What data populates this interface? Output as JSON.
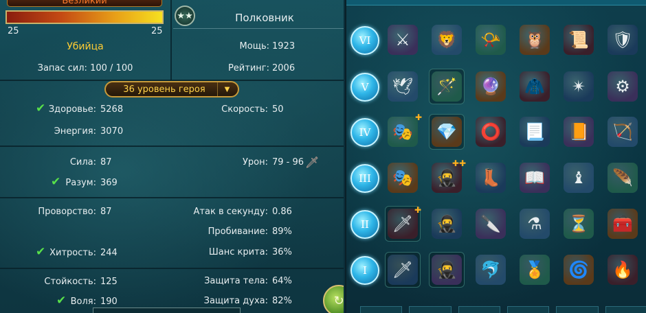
{
  "hero": {
    "name": "Безликий",
    "level_min": "25",
    "level_max": "25",
    "xp_fraction": 1.0,
    "class": "Убийца",
    "stamina_label": "Запас сил:",
    "stamina_value": "100 / 100",
    "rank_icon": "laurel-stars-icon",
    "rank": "Полковник",
    "power_label": "Мощь:",
    "power_value": "1923",
    "rating_label": "Рейтинг:",
    "rating_value": "2006",
    "level_selector": "36 уровень героя"
  },
  "stats": {
    "health_label": "Здоровье:",
    "health_value": "5268",
    "speed_label": "Скорость:",
    "speed_value": "50",
    "energy_label": "Энергия:",
    "energy_value": "3070",
    "strength_label": "Сила:",
    "strength_value": "87",
    "damage_label": "Урон:",
    "damage_value": "79 - 96",
    "mind_label": "Разум:",
    "mind_value": "369",
    "agility_label": "Проворство:",
    "agility_value": "87",
    "aps_label": "Атак в секунду:",
    "aps_value": "0.86",
    "pierce_label": "Пробивание:",
    "pierce_value": "89%",
    "cunning_label": "Хитрость:",
    "cunning_value": "244",
    "crit_label": "Шанс крита:",
    "crit_value": "36%",
    "stamina2_label": "Стойкость:",
    "stamina2_value": "125",
    "body_def_label": "Защита тела:",
    "body_def_value": "64%",
    "will_label": "Воля:",
    "will_value": "190",
    "spirit_def_label": "Защита духа:",
    "spirit_def_value": "82%"
  },
  "colors": {
    "accent_gold": "#ffcc33",
    "check_green": "#58e04a",
    "tier_blue": "#2fb6e8"
  },
  "talents": {
    "tiers": [
      "VI",
      "V",
      "IV",
      "III",
      "II",
      "I"
    ],
    "rows": [
      [
        {
          "icon": "winged-sword-icon",
          "glyph": "⚔"
        },
        {
          "icon": "golden-beast-icon",
          "glyph": "🦁"
        },
        {
          "icon": "curved-horn-icon",
          "glyph": "📯"
        },
        {
          "icon": "owl-banner-icon",
          "glyph": "🦉"
        },
        {
          "icon": "magic-scroll-icon",
          "glyph": "📜"
        },
        {
          "icon": "shield-sword-icon",
          "glyph": "🛡"
        }
      ],
      [
        {
          "icon": "silver-wings-icon",
          "glyph": "🕊"
        },
        {
          "icon": "ruby-wand-icon",
          "glyph": "🪄"
        },
        {
          "icon": "emerald-staff-icon",
          "glyph": "🔮"
        },
        {
          "icon": "green-cloak-icon",
          "glyph": "🧥"
        },
        {
          "icon": "spinning-blades-icon",
          "glyph": "✴"
        },
        {
          "icon": "spiked-mace-icon",
          "glyph": "⚙"
        }
      ],
      [
        {
          "icon": "white-mask-icon",
          "glyph": "🎭"
        },
        {
          "icon": "prism-crystal-icon",
          "glyph": "💎"
        },
        {
          "icon": "gold-bracelet-icon",
          "glyph": "⭕"
        },
        {
          "icon": "rune-scroll-icon",
          "glyph": "📃"
        },
        {
          "icon": "ancient-tome-icon",
          "glyph": "📙"
        },
        {
          "icon": "green-arrow-icon",
          "glyph": "🏹"
        }
      ],
      [
        {
          "icon": "white-mask-icon",
          "glyph": "🎭"
        },
        {
          "icon": "hooded-rogue-icon",
          "glyph": "🥷"
        },
        {
          "icon": "iron-boots-icon",
          "glyph": "👢"
        },
        {
          "icon": "open-book-icon",
          "glyph": "📖"
        },
        {
          "icon": "chess-bishop-icon",
          "glyph": "♝"
        },
        {
          "icon": "feathered-dagger-icon",
          "glyph": "🪶"
        }
      ],
      [
        {
          "icon": "red-dagger-icon",
          "glyph": "🗡"
        },
        {
          "icon": "hooded-rogue-icon",
          "glyph": "🥷"
        },
        {
          "icon": "arcane-dagger-icon",
          "glyph": "🔪"
        },
        {
          "icon": "potion-flask-icon",
          "glyph": "⚗"
        },
        {
          "icon": "hourglass-icon",
          "glyph": "⏳"
        },
        {
          "icon": "treasure-chest-icon",
          "glyph": "🧰"
        }
      ],
      [
        {
          "icon": "red-dagger-icon",
          "glyph": "🗡"
        },
        {
          "icon": "hooded-rogue-icon",
          "glyph": "🥷"
        },
        {
          "icon": "blue-dolphin-icon",
          "glyph": "🐬"
        },
        {
          "icon": "lion-medallion-icon",
          "glyph": "🏅"
        },
        {
          "icon": "pinwheel-icon",
          "glyph": "🌀"
        },
        {
          "icon": "fire-scroll-icon",
          "glyph": "🔥"
        }
      ]
    ]
  }
}
